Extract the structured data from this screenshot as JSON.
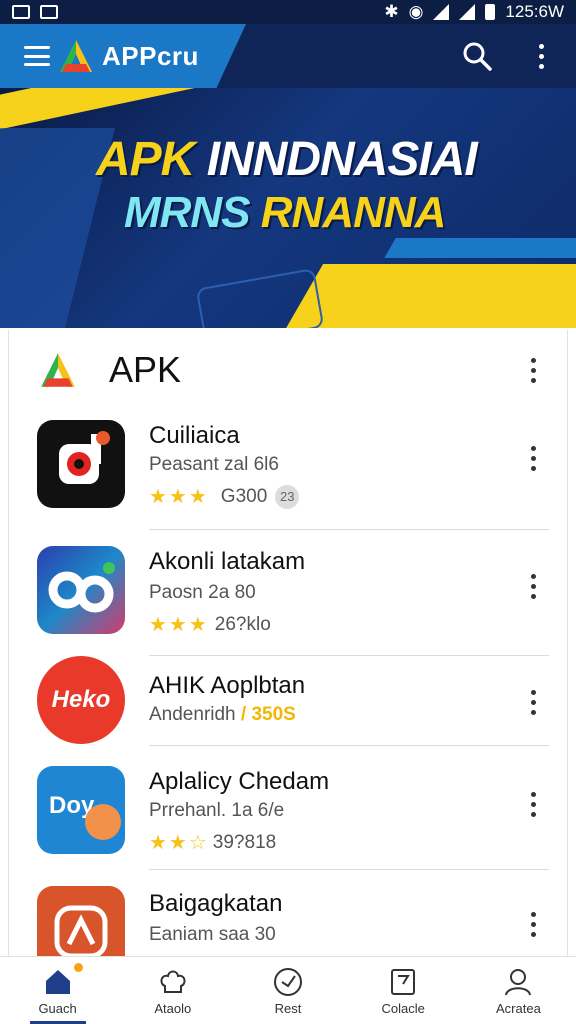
{
  "status_bar": {
    "time": "125:6W"
  },
  "app_bar": {
    "brand": "APPcru",
    "icons": [
      "menu-icon",
      "search-icon",
      "more-vert-icon"
    ]
  },
  "banner": {
    "title_part1": "APK ",
    "title_part2": "INNDNASIAI",
    "subtitle_part1": "MRNS ",
    "subtitle_part2": "RNANNA"
  },
  "section": {
    "title": "APK"
  },
  "apps": [
    {
      "name": "Cuiliaica",
      "sub": "Peasant zal 6l6",
      "stars": "★★★",
      "rating_text": "G300",
      "badge": "23"
    },
    {
      "name": "Akonli latakam",
      "sub": "Paosn 2a 80",
      "stars": "★★★",
      "rating_text": "26?klo"
    },
    {
      "name": "AHIK Aoplbtan",
      "sub_prefix": "Andenridh ",
      "sub_highlight": "/ 350S"
    },
    {
      "name": "Aplalicy Chedam",
      "sub": "Prrehanl. 1a 6/e",
      "stars": "★★☆",
      "rating_text": "39?818"
    },
    {
      "name": "Baigagkatan",
      "sub": "Eaniam saa 30"
    }
  ],
  "app_icon_labels": {
    "app3": "Heko",
    "app4": "Doy"
  },
  "bottom_nav": [
    {
      "label": "Guach"
    },
    {
      "label": "Ataolo"
    },
    {
      "label": "Rest"
    },
    {
      "label": "Colacle"
    },
    {
      "label": "Acratea"
    }
  ],
  "colors": {
    "navy": "#0f2557",
    "accent_blue": "#1b78c6",
    "yellow": "#f6d21a",
    "star": "#f6c21a"
  }
}
